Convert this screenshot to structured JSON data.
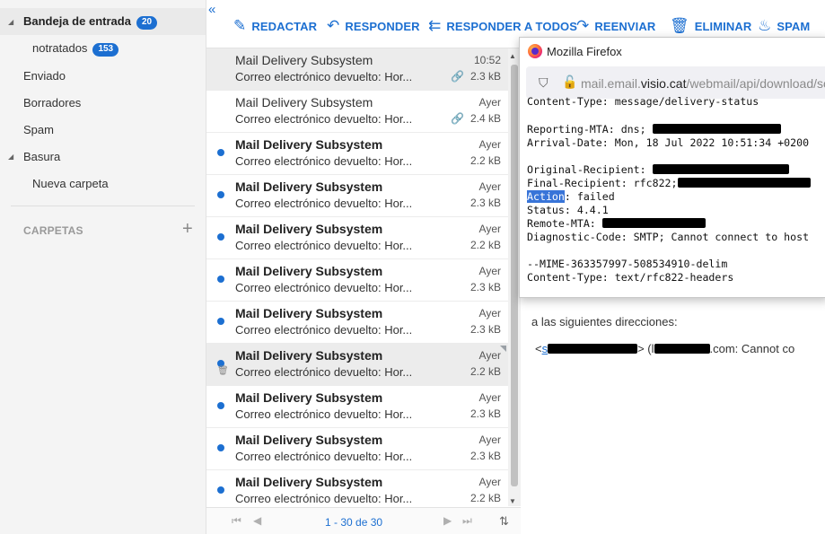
{
  "folders": {
    "items": [
      {
        "label": "Bandeja de entrada",
        "badge": "20"
      },
      {
        "label": "notratados",
        "badge": "153"
      },
      {
        "label": "Enviado"
      },
      {
        "label": "Borradores"
      },
      {
        "label": "Spam"
      },
      {
        "label": "Basura"
      },
      {
        "label": "Nueva carpeta"
      }
    ],
    "section_label": "CARPETAS",
    "add_icon": "plus-icon"
  },
  "toolbar": {
    "compose": "REDACTAR",
    "reply": "RESPONDER",
    "reply_all": "RESPONDER A TODOS",
    "forward": "REENVIAR",
    "delete": "ELIMINAR",
    "spam": "SPAM"
  },
  "messages": [
    {
      "from": "Mail Delivery Subsystem",
      "subject": "Correo electrónico devuelto: Hor...",
      "date": "10:52",
      "size": "2.3 kB"
    },
    {
      "from": "Mail Delivery Subsystem",
      "subject": "Correo electrónico devuelto: Hor...",
      "date": "Ayer",
      "size": "2.4 kB"
    },
    {
      "from": "Mail Delivery Subsystem",
      "subject": "Correo electrónico devuelto: Hor...",
      "date": "Ayer",
      "size": "2.2 kB"
    },
    {
      "from": "Mail Delivery Subsystem",
      "subject": "Correo electrónico devuelto: Hor...",
      "date": "Ayer",
      "size": "2.3 kB"
    },
    {
      "from": "Mail Delivery Subsystem",
      "subject": "Correo electrónico devuelto: Hor...",
      "date": "Ayer",
      "size": "2.2 kB"
    },
    {
      "from": "Mail Delivery Subsystem",
      "subject": "Correo electrónico devuelto: Hor...",
      "date": "Ayer",
      "size": "2.3 kB"
    },
    {
      "from": "Mail Delivery Subsystem",
      "subject": "Correo electrónico devuelto: Hor...",
      "date": "Ayer",
      "size": "2.3 kB"
    },
    {
      "from": "Mail Delivery Subsystem",
      "subject": "Correo electrónico devuelto: Hor...",
      "date": "Ayer",
      "size": "2.2 kB"
    },
    {
      "from": "Mail Delivery Subsystem",
      "subject": "Correo electrónico devuelto: Hor...",
      "date": "Ayer",
      "size": "2.3 kB"
    },
    {
      "from": "Mail Delivery Subsystem",
      "subject": "Correo electrónico devuelto: Hor...",
      "date": "Ayer",
      "size": "2.3 kB"
    },
    {
      "from": "Mail Delivery Subsystem",
      "subject": "Correo electrónico devuelto: Hor...",
      "date": "Ayer",
      "size": "2.2 kB"
    }
  ],
  "pager": {
    "count": "1 - 30 de 30"
  },
  "firefox": {
    "title": "Mozilla Firefox",
    "url_prefix": "mail.email.",
    "url_host": "visio.cat",
    "url_suffix": "/webmail/api/download/so",
    "lines": {
      "content_type": "Content-Type: message/delivery-status",
      "reporting_mta": "Reporting-MTA: dns;",
      "arrival_date": "Arrival-Date: Mon, 18 Jul 2022 10:51:34 +0200",
      "original_recipient": "Original-Recipient:",
      "final_recipient": "Final-Recipient: rfc822;",
      "action_key": "Action",
      "action_value": ": failed",
      "status": "Status: 4.4.1",
      "remote_mta": "Remote-MTA:",
      "diagnostic": "Diagnostic-Code: SMTP; Cannot connect to host",
      "mime": "--MIME-363357997-508534910-delim",
      "content_type2": "Content-Type: text/rfc822-headers"
    }
  },
  "reading": {
    "line1": "a las siguientes direcciones:",
    "line2_prefix": "<",
    "line2_link": "s",
    "line2_mid": "> (l",
    "line2_tail": ".com: Cannot co"
  },
  "colors": {
    "accent": "#1c6fd1",
    "selection": "#3874d8"
  }
}
